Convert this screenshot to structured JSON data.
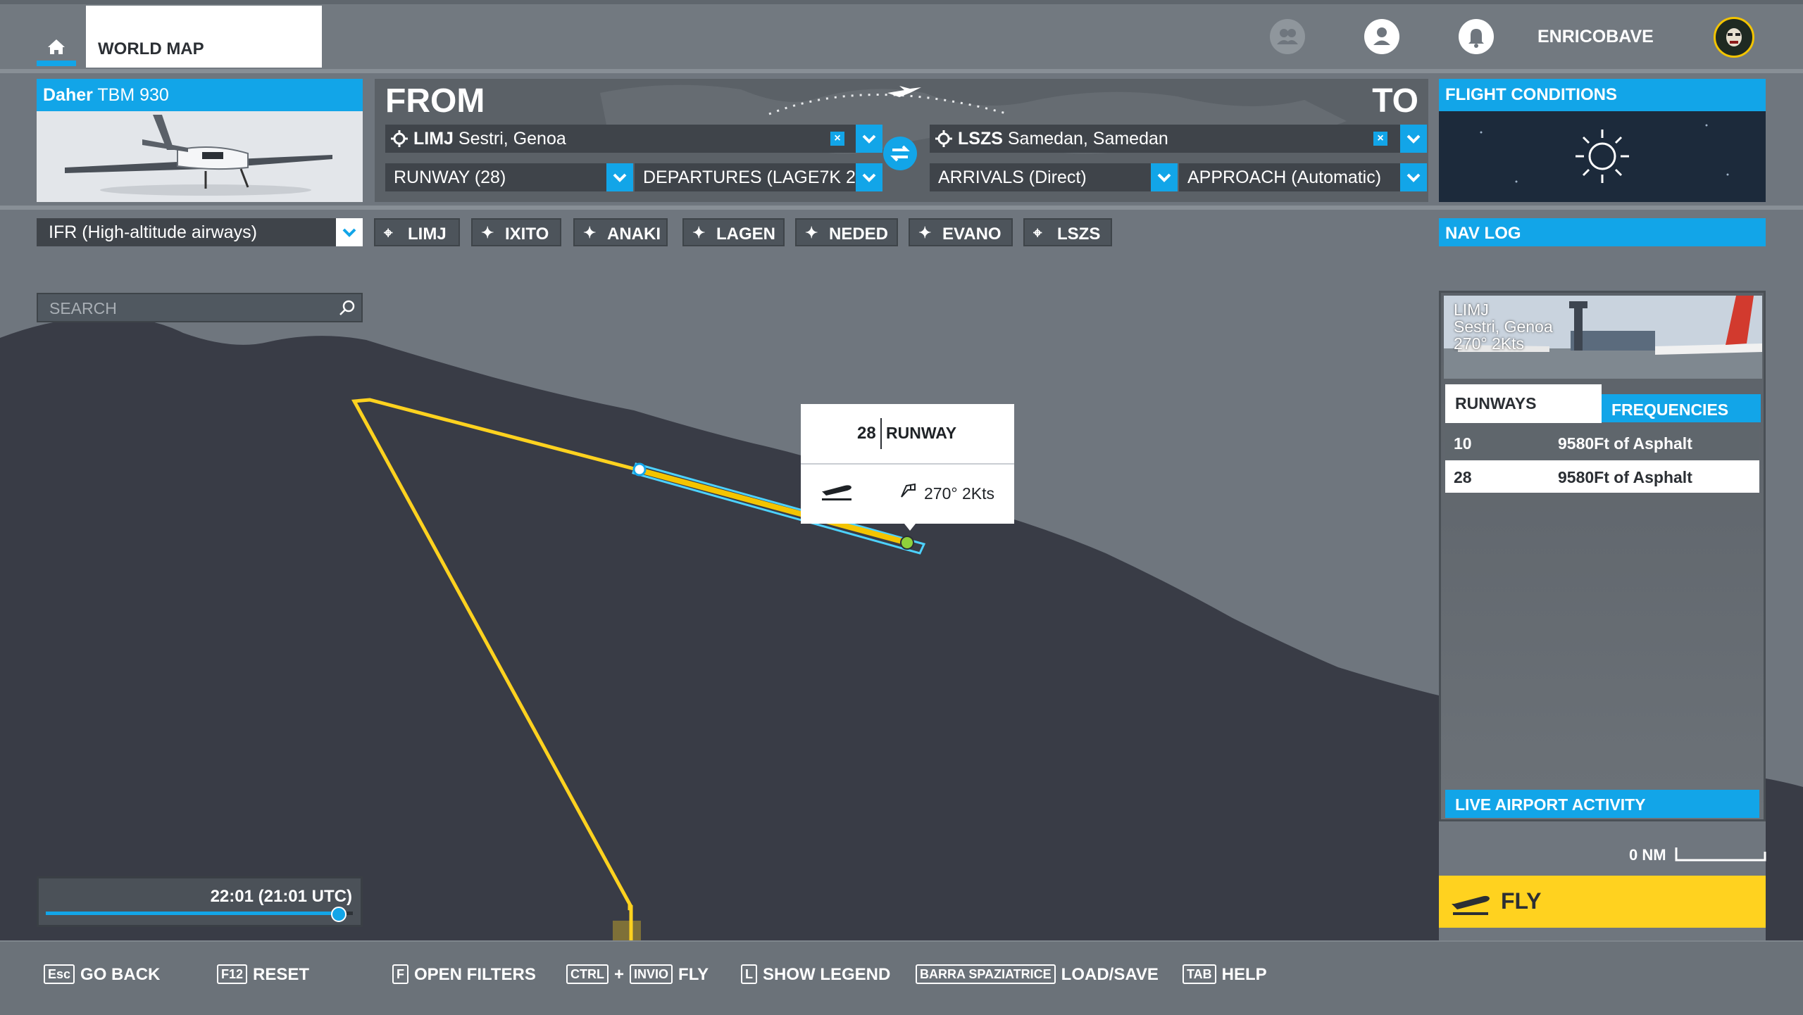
{
  "top_bar": {
    "world_map_tab": "WORLD MAP",
    "username": "ENRICOBAVE"
  },
  "aircraft": {
    "brand": "Daher",
    "model": "TBM 930"
  },
  "route": {
    "from_label": "FROM",
    "to_label": "TO",
    "departure": {
      "icao": "LIMJ",
      "name": "Sestri, Genoa"
    },
    "arrival": {
      "icao": "LSZS",
      "name": "Samedan, Samedan"
    },
    "runway_select": "RUNWAY (28)",
    "departures_select": "DEPARTURES (LAGE7K 2",
    "arrivals_select": "ARRIVALS (Direct)",
    "approach_select": "APPROACH (Automatic)",
    "clear_symbol": "×"
  },
  "flight_conditions": {
    "label": "FLIGHT CONDITIONS"
  },
  "flight_plan": {
    "type_select": "IFR (High-altitude airways)",
    "waypoints": [
      {
        "label": "LIMJ",
        "kind": "airport"
      },
      {
        "label": "IXITO",
        "kind": "waypoint"
      },
      {
        "label": "ANAKI",
        "kind": "waypoint"
      },
      {
        "label": "LAGEN",
        "kind": "waypoint"
      },
      {
        "label": "NEDED",
        "kind": "waypoint"
      },
      {
        "label": "EVANO",
        "kind": "waypoint"
      },
      {
        "label": "LSZS",
        "kind": "airport"
      }
    ]
  },
  "nav_log": {
    "label": "NAV LOG"
  },
  "search": {
    "placeholder": "SEARCH"
  },
  "runway_popup": {
    "number": "28",
    "label": "RUNWAY",
    "wind": "270° 2Kts"
  },
  "airport_panel": {
    "icao": "LIMJ",
    "name": "Sestri, Genoa",
    "wind": "270° 2Kts",
    "tab_runways": "RUNWAYS",
    "tab_frequencies": "FREQUENCIES",
    "runways": [
      {
        "number": "10",
        "description": "9580Ft of Asphalt"
      },
      {
        "number": "28",
        "description": "9580Ft of Asphalt"
      }
    ],
    "live_activity": "LIVE AIRPORT ACTIVITY"
  },
  "scale": {
    "label": "0 NM"
  },
  "fly_button": {
    "label": "FLY"
  },
  "time": {
    "label": "22:01 (21:01 UTC)",
    "slider_fraction": 0.95
  },
  "bottom_hints": {
    "back_key": "Esc",
    "back_label": "GO BACK",
    "reset_key": "F12",
    "reset_label": "RESET",
    "filters_key": "F",
    "filters_label": "OPEN FILTERS",
    "fly_key1": "CTRL",
    "fly_plus": "+",
    "fly_key2": "INVIO",
    "fly_label": "FLY",
    "legend_key": "L",
    "legend_label": "SHOW LEGEND",
    "loadsave_key": "BARRA SPAZIATRICE",
    "loadsave_label": "LOAD/SAVE",
    "help_key": "TAB",
    "help_label": "HELP"
  },
  "colors": {
    "accent": "#12a5e8",
    "route_line": "#ffd21f",
    "terrain": "#3a3d47",
    "water": "#6f767e"
  }
}
